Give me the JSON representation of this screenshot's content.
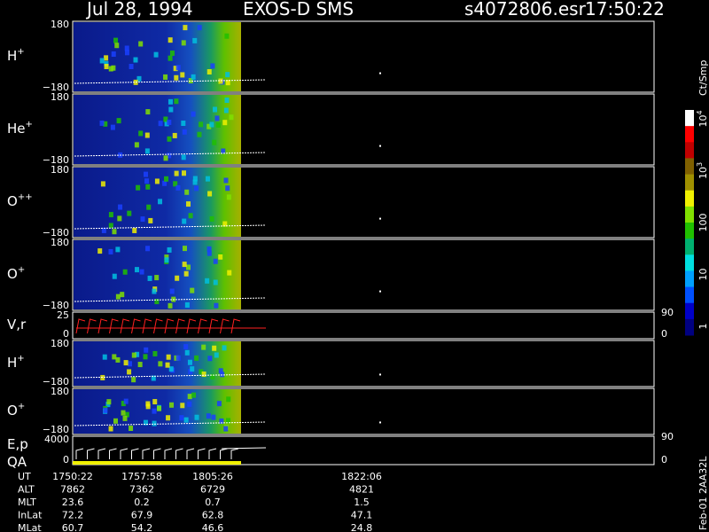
{
  "header": {
    "date": "Jul 28, 1994",
    "instrument": "EXOS-D SMS",
    "file": "s4072806.esr",
    "time": "17:50:22"
  },
  "colorbar": {
    "units": "Ct/Smp",
    "labels": [
      "1",
      "10",
      "100",
      "10^3",
      "10^4"
    ],
    "colors": [
      "#000080",
      "#0000c8",
      "#0050ff",
      "#00a0ff",
      "#00e0e0",
      "#00b070",
      "#20c000",
      "#80e000",
      "#f0f000",
      "#a09000",
      "#806000",
      "#c00000",
      "#ff0000",
      "#ffffff"
    ]
  },
  "panels": [
    {
      "id": "h-plus-1",
      "label": "H",
      "sup": "+",
      "ytop": "180",
      "ybot": "−180",
      "right_tick": ""
    },
    {
      "id": "he-plus",
      "label": "He",
      "sup": "+",
      "ytop": "180",
      "ybot": "−180",
      "right_tick": ""
    },
    {
      "id": "o-plusplus",
      "label": "O",
      "sup": "++",
      "ytop": "180",
      "ybot": "−180",
      "right_tick": ""
    },
    {
      "id": "o-plus-1",
      "label": "O",
      "sup": "+",
      "ytop": "180",
      "ybot": "−180",
      "right_tick": ""
    },
    {
      "id": "vr",
      "label": "V,r",
      "sup": "",
      "ytop": "25",
      "ybot": "0",
      "right_top": "90",
      "right_bot": "0"
    },
    {
      "id": "h-plus-2",
      "label": "H",
      "sup": "+",
      "ytop": "180",
      "ybot": "−180",
      "right_tick": ""
    },
    {
      "id": "o-plus-2",
      "label": "O",
      "sup": "+",
      "ytop": "180",
      "ybot": "−180",
      "right_tick": ""
    },
    {
      "id": "ep",
      "label": "E,p",
      "label2": "QA",
      "sup": "",
      "ytop": "4000",
      "ybot": "0",
      "right_top": "90",
      "right_bot": "0"
    }
  ],
  "ephemeris": {
    "row_labels": [
      "UT",
      "ALT",
      "MLT",
      "InLat",
      "MLat"
    ],
    "columns": [
      {
        "UT": "1750:22",
        "ALT": "7862",
        "MLT": "23.6",
        "InLat": "72.2",
        "MLat": "60.7"
      },
      {
        "UT": "1757:58",
        "ALT": "7362",
        "MLT": "0.2",
        "InLat": "67.9",
        "MLat": "54.2"
      },
      {
        "UT": "1805:26",
        "ALT": "6729",
        "MLT": "0.7",
        "InLat": "62.8",
        "MLat": "46.6"
      },
      {
        "UT": "1822:06",
        "ALT": "4821",
        "MLT": "1.5",
        "InLat": "47.1",
        "MLat": "24.8"
      }
    ]
  },
  "footer": {
    "stamp": "Feb-01 2AA32L"
  },
  "chart_data": {
    "type": "heatmap",
    "title": "Jul 28, 1994   EXOS-D SMS",
    "xlabel": "UT",
    "x_ticks": [
      "1750:22",
      "1757:58",
      "1805:26",
      "1822:06"
    ],
    "data_end_ut": "1805:26",
    "panels": [
      "H+",
      "He+",
      "O++",
      "O+",
      "V,r",
      "H+",
      "O+",
      "E,p / QA"
    ],
    "pitch_angle_range": [
      -180,
      180
    ],
    "colorscale": "log",
    "colorbar_range": [
      1,
      10000
    ]
  }
}
